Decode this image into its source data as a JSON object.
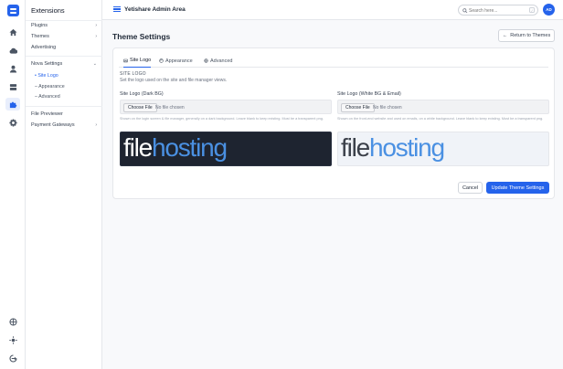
{
  "app": {
    "title": "Yetishare Admin Area",
    "avatar_initials": "AD",
    "accent": "#2563eb"
  },
  "search": {
    "placeholder": "Search here...",
    "shortcut": "/"
  },
  "rail": {
    "icons": [
      "home-icon",
      "cloud-upload-icon",
      "user-icon",
      "server-icon",
      "puzzle-icon",
      "gear-icon",
      "globe-icon",
      "sun-icon",
      "logout-icon"
    ],
    "active": "puzzle-icon"
  },
  "subnav": {
    "heading": "Extensions",
    "items": [
      {
        "label": "Plugins",
        "has_children": true
      },
      {
        "label": "Themes",
        "has_children": true
      },
      {
        "label": "Advertising",
        "has_children": false
      },
      {
        "label": "Nova Settings",
        "has_children": true,
        "expanded": true
      },
      {
        "label": "File Previewer",
        "has_children": false
      },
      {
        "label": "Payment Gateways",
        "has_children": true
      }
    ],
    "nova_children": [
      {
        "label": "Site Logo",
        "active": true
      },
      {
        "label": "Appearance",
        "active": false
      },
      {
        "label": "Advanced",
        "active": false
      }
    ]
  },
  "page": {
    "title": "Theme Settings",
    "return_label": "Return to Themes"
  },
  "tabs": [
    {
      "label": "Site Logo",
      "active": true
    },
    {
      "label": "Appearance",
      "active": false
    },
    {
      "label": "Advanced",
      "active": false
    }
  ],
  "section": {
    "label": "SITE LOGO",
    "description": "Set the logo used on the site and file manager views."
  },
  "fields": {
    "dark": {
      "label": "Site Logo (Dark BG)",
      "button": "Choose File",
      "status": "No file chosen",
      "help": "Shown on the login screen & file manager, generally on a dark background. Leave blank to keep existing. Must be a transparent png."
    },
    "light": {
      "label": "Site Logo (White BG & Email)",
      "button": "Choose File",
      "status": "No file chosen",
      "help": "Shown on the front-end website and used on emails, on a white background. Leave blank to keep existing. Must be a transparent png."
    }
  },
  "logo": {
    "part1": "file",
    "part2": "hosting"
  },
  "actions": {
    "cancel": "Cancel",
    "update": "Update Theme Settings"
  }
}
